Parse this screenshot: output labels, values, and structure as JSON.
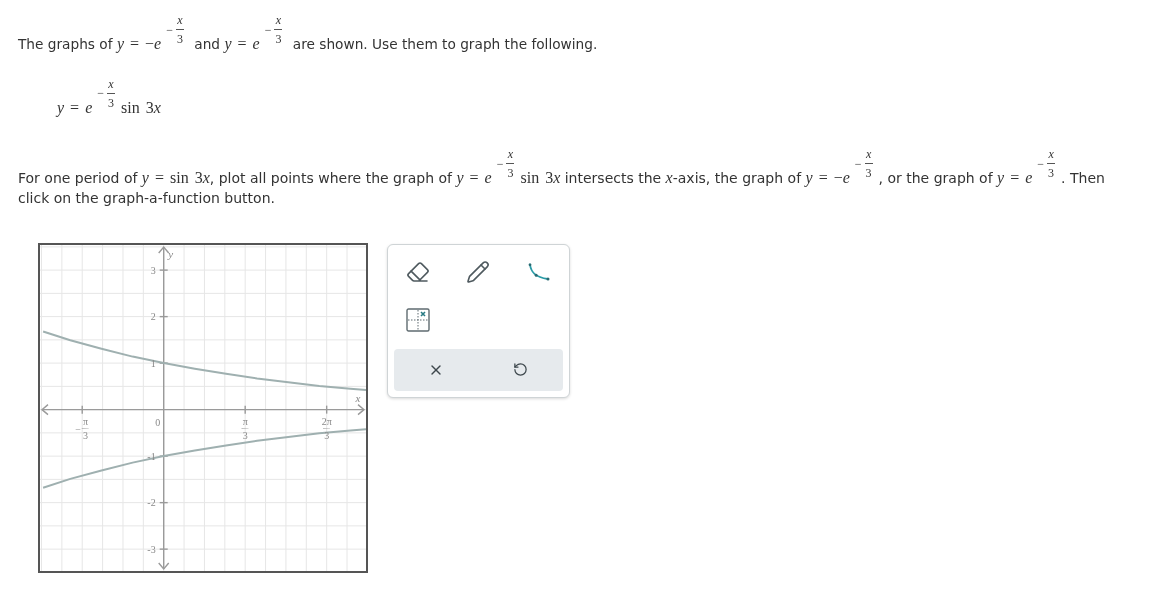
{
  "intro": {
    "segments": [
      {
        "kind": "text",
        "text": "The graphs of "
      },
      {
        "kind": "power",
        "base": "*y* = −*e*",
        "exponent": {
          "sign": "−",
          "num": "*x*",
          "den": "3"
        }
      },
      {
        "kind": "text",
        "text": " and "
      },
      {
        "kind": "power",
        "base": "*y* = *e*",
        "exponent": {
          "sign": "−",
          "num": "*x*",
          "den": "3"
        }
      },
      {
        "kind": "text",
        "text": " are shown. Use them to graph the following."
      }
    ]
  },
  "function": {
    "segments": [
      {
        "kind": "power",
        "base": "*y* = *e*",
        "exponent": {
          "sign": "−",
          "num": "*x*",
          "den": "3"
        }
      },
      {
        "kind": "math",
        "text": "sin 3"
      },
      {
        "kind": "var",
        "text": "x"
      }
    ]
  },
  "instruction": {
    "segments": [
      {
        "kind": "text",
        "text": "For one period of "
      },
      {
        "kind": "math",
        "text": "*y* = sin 3"
      },
      {
        "kind": "var",
        "text": "x"
      },
      {
        "kind": "text",
        "text": ", plot all points where the graph of "
      },
      {
        "kind": "power",
        "base": "*y* = *e*",
        "exponent": {
          "sign": "−",
          "num": "*x*",
          "den": "3"
        }
      },
      {
        "kind": "math",
        "text": "sin 3"
      },
      {
        "kind": "var",
        "text": "x"
      },
      {
        "kind": "text",
        "text": " intersects the "
      },
      {
        "kind": "var",
        "text": "x"
      },
      {
        "kind": "text",
        "text": "-axis, the graph of "
      },
      {
        "kind": "power",
        "base": "*y* = −*e*",
        "exponent": {
          "sign": "−",
          "num": "*x*",
          "den": "3"
        }
      },
      {
        "kind": "text",
        "text": ", or the graph of "
      },
      {
        "kind": "power",
        "base": "*y* = *e*",
        "exponent": {
          "sign": "−",
          "num": "*x*",
          "den": "3"
        }
      },
      {
        "kind": "text",
        "text": ". Then click on the graph-a-function button."
      }
    ]
  },
  "graph": {
    "origin_label": "0",
    "chart_data": {
      "type": "line",
      "grid": true,
      "xlabel": "x",
      "ylabel": "y",
      "x": [
        -1.55,
        -1.2,
        -0.8,
        -0.4,
        0,
        0.4,
        0.8,
        1.2,
        1.6,
        2.0,
        2.4,
        2.6
      ],
      "series": [
        {
          "values": [
            1.68,
            1.49,
            1.31,
            1.14,
            1.0,
            0.88,
            0.77,
            0.67,
            0.59,
            0.51,
            0.45,
            0.42
          ]
        },
        {
          "values": [
            -1.68,
            -1.49,
            -1.31,
            -1.14,
            -1.0,
            -0.88,
            -0.77,
            -0.67,
            -0.59,
            -0.51,
            -0.45,
            -0.42
          ]
        }
      ],
      "xlim": [
        -1.59,
        2.6
      ],
      "ylim": [
        -3.47,
        3.54
      ],
      "xticks": [
        {
          "value": -1.0472,
          "label": "−π/3"
        },
        {
          "value": 1.0472,
          "label": "π/3"
        },
        {
          "value": 2.0944,
          "label": "2π/3"
        }
      ],
      "yticks": [
        {
          "value": -3,
          "label": "-3"
        },
        {
          "value": -2,
          "label": "-2"
        },
        {
          "value": -1,
          "label": "-1"
        },
        {
          "value": 1,
          "label": "1"
        },
        {
          "value": 2,
          "label": "2"
        },
        {
          "value": 3,
          "label": "3"
        }
      ]
    }
  },
  "tools": [
    {
      "kind": "eraser"
    },
    {
      "kind": "pencil"
    },
    {
      "kind": "curve"
    },
    {
      "kind": "graph_function"
    }
  ],
  "actions": [
    {
      "kind": "clear"
    },
    {
      "kind": "undo"
    }
  ]
}
